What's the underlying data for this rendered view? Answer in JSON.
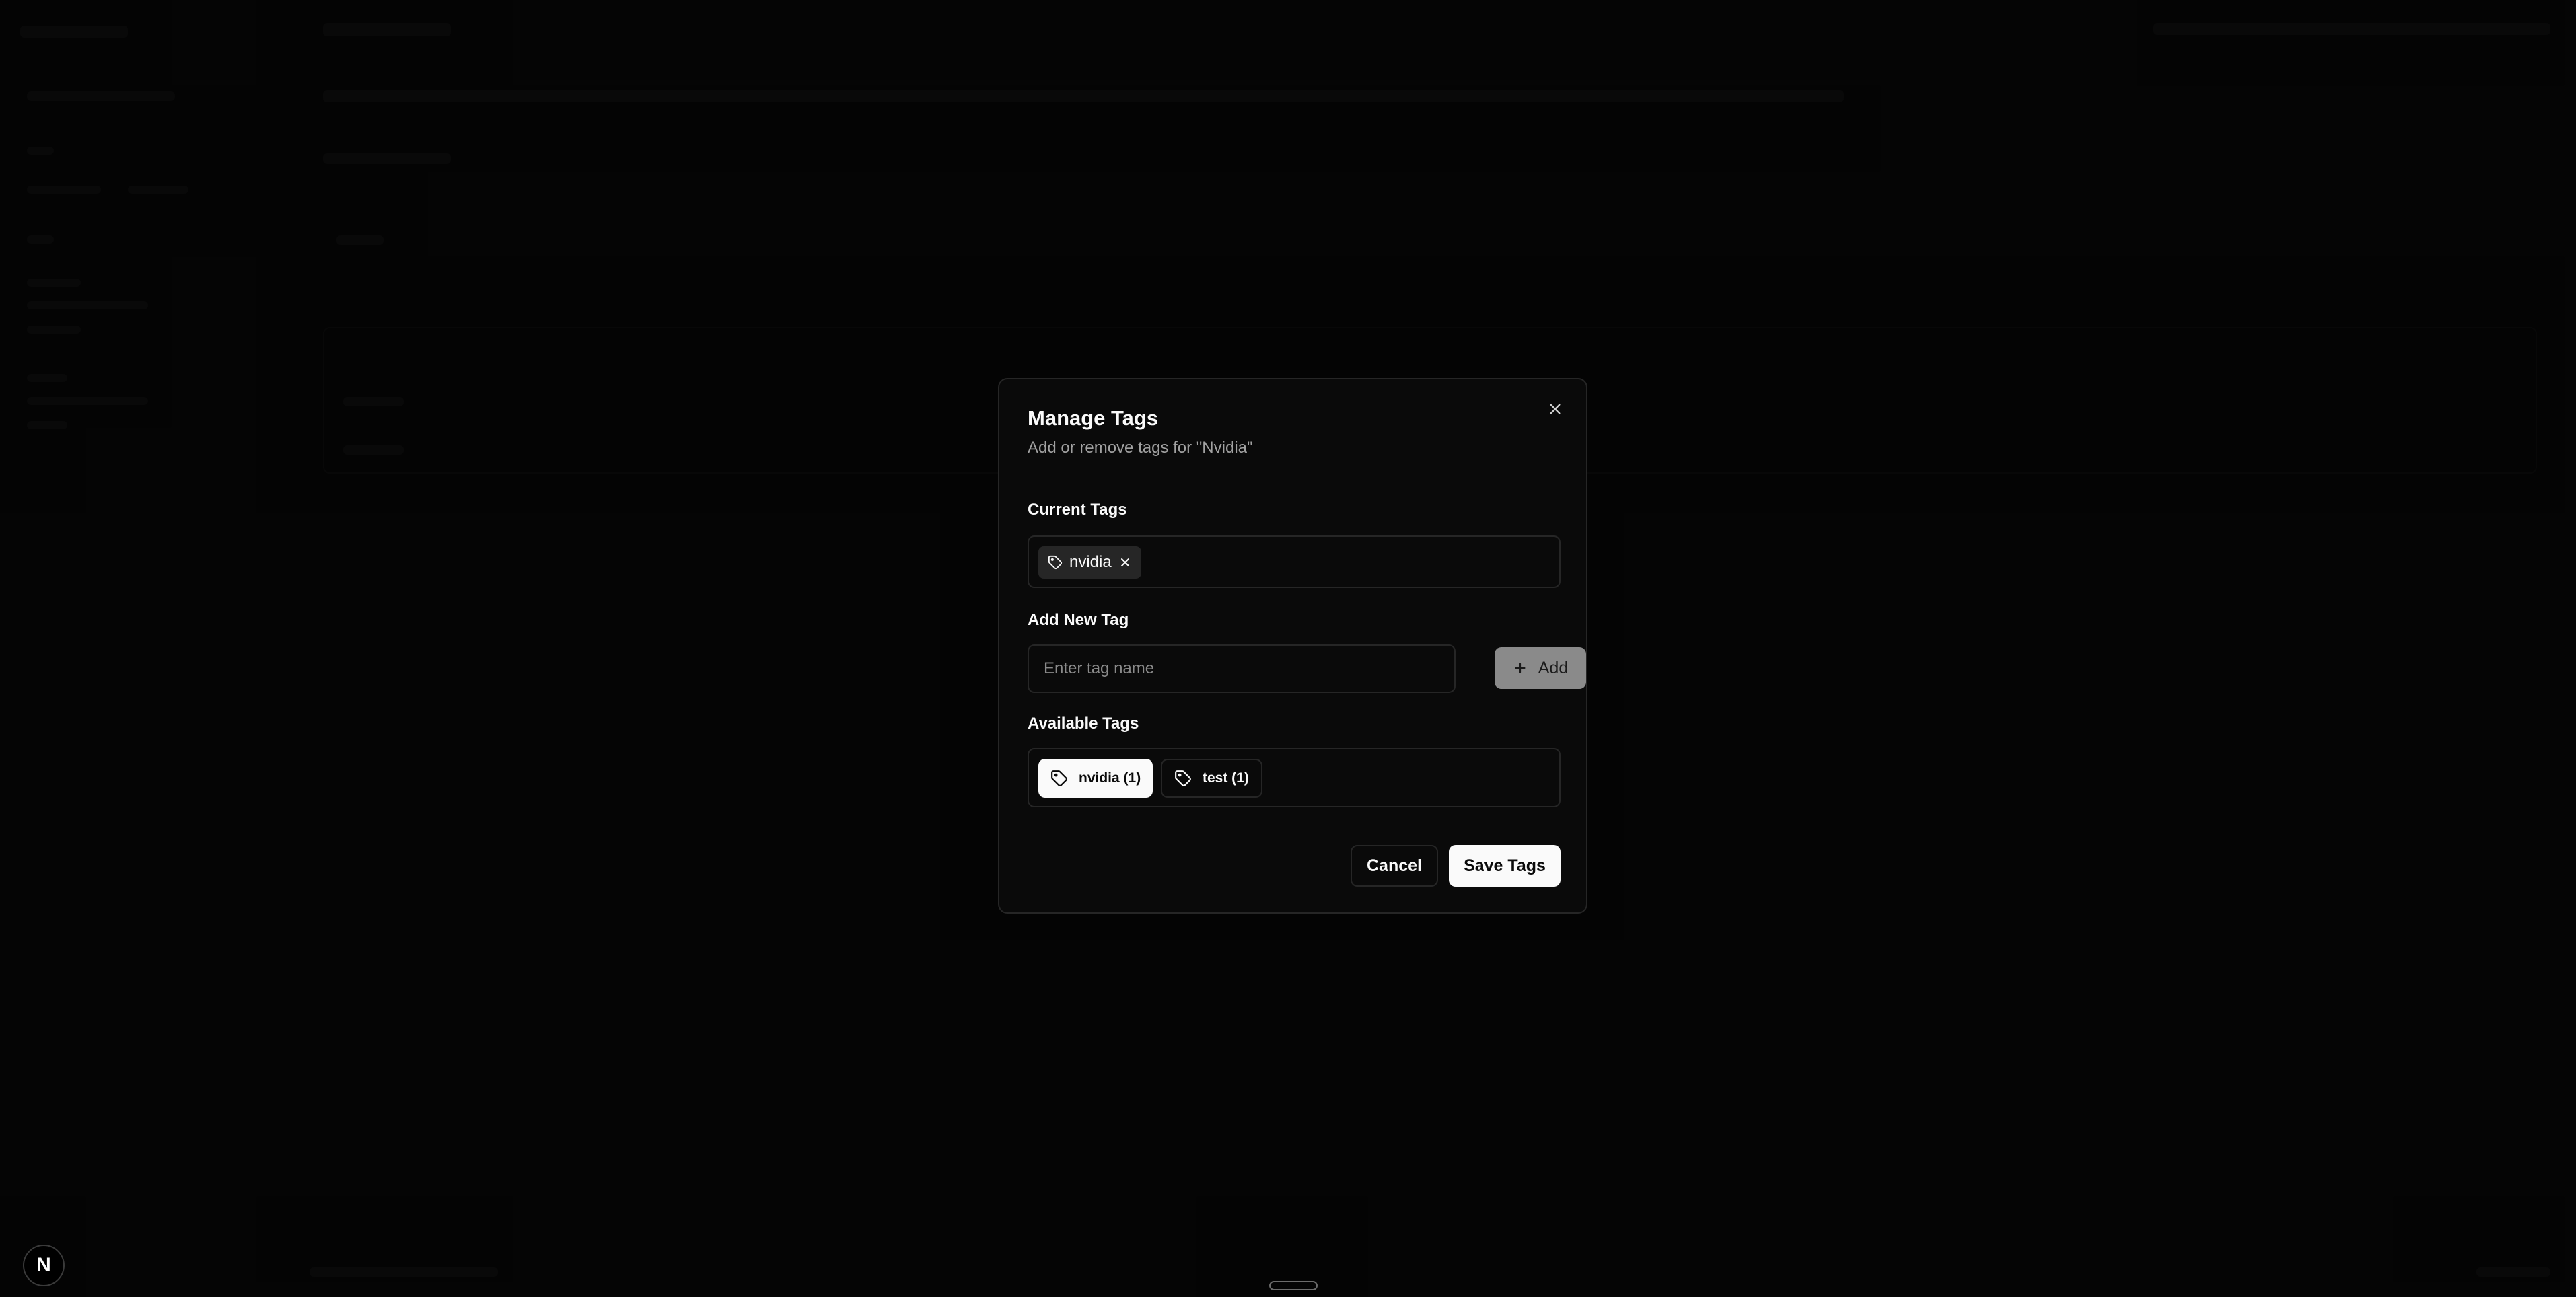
{
  "dialog": {
    "title": "Manage Tags",
    "description": "Add or remove tags for \"Nvidia\"",
    "close_icon": "close-icon",
    "current_tags_label": "Current Tags",
    "current_tags": [
      {
        "label": "nvidia",
        "icon": "tag-icon",
        "remove_icon": "x-icon"
      }
    ],
    "add_new_tag_label": "Add New Tag",
    "tag_input": {
      "placeholder": "Enter tag name",
      "value": ""
    },
    "add_button": {
      "label": "Add",
      "icon": "plus-icon",
      "enabled": false
    },
    "available_tags_label": "Available Tags",
    "available_tags": [
      {
        "label": "nvidia (1)",
        "icon": "tag-icon",
        "selected": true
      },
      {
        "label": "test (1)",
        "icon": "tag-icon",
        "selected": false
      }
    ],
    "cancel_label": "Cancel",
    "save_label": "Save Tags"
  },
  "badge": {
    "letter": "N"
  },
  "colors": {
    "background": "#0a0a0a",
    "border": "#262626",
    "primary": "#fafafa",
    "muted_text": "#a1a1a1",
    "disabled_button": "#8a8a8a"
  }
}
